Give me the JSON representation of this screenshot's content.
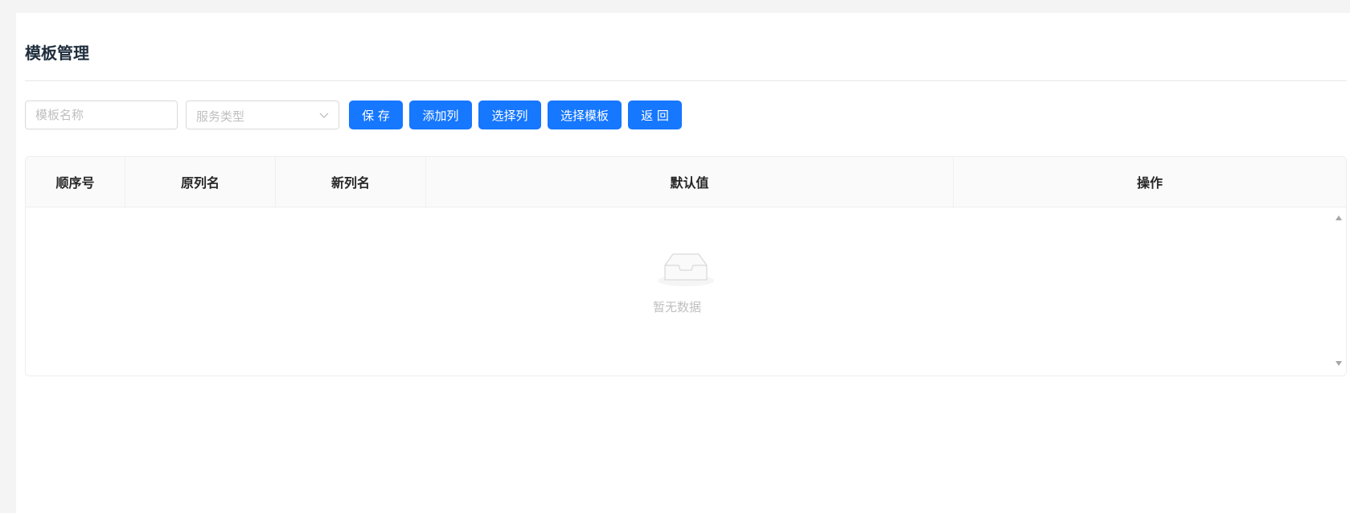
{
  "page": {
    "title": "模板管理"
  },
  "toolbar": {
    "name_placeholder": "模板名称",
    "type_placeholder": "服务类型",
    "buttons": [
      "保 存",
      "添加列",
      "选择列",
      "选择模板",
      "返 回"
    ]
  },
  "table": {
    "columns": [
      "顺序号",
      "原列名",
      "新列名",
      "默认值",
      "操作"
    ],
    "rows": [],
    "empty_text": "暂无数据"
  },
  "colors": {
    "primary": "#1677ff",
    "background": "#f4f4f4"
  }
}
